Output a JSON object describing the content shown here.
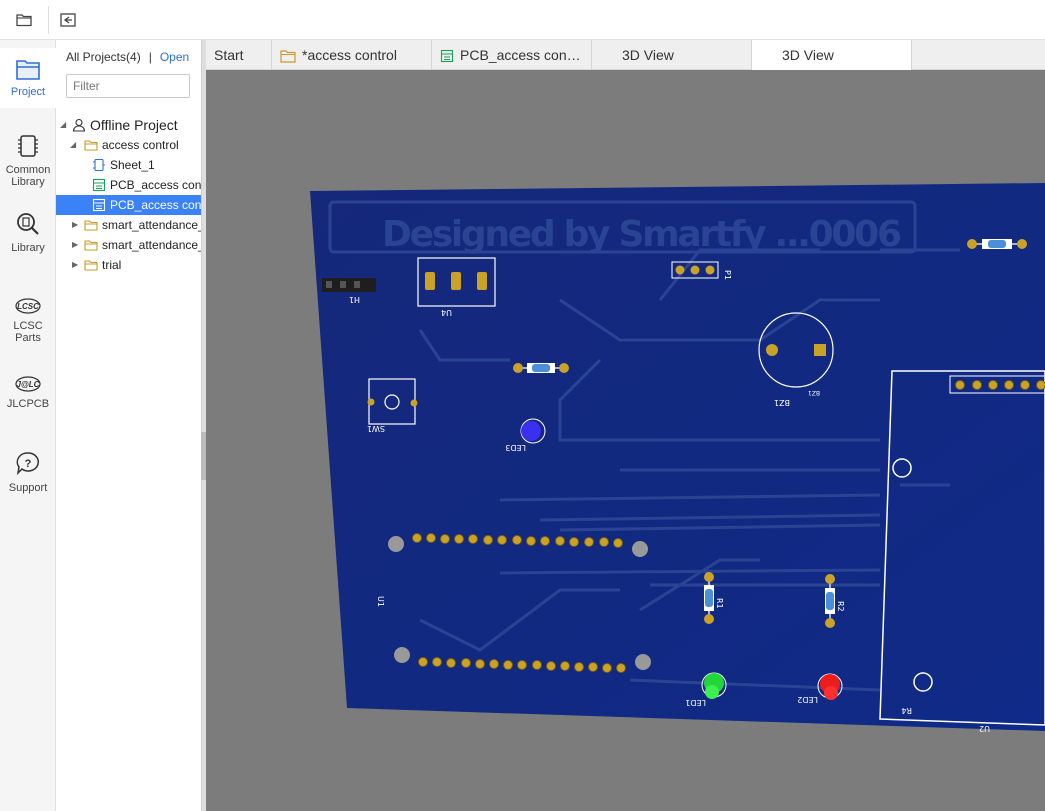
{
  "rail": {
    "items": [
      {
        "label": "Project",
        "icon": "project-icon"
      },
      {
        "label": "Common\nLibrary",
        "icon": "chip-icon"
      },
      {
        "label": "Library",
        "icon": "library-search-icon"
      },
      {
        "label": "LCSC\nParts",
        "icon": "lcsc-icon"
      },
      {
        "label": "JLCPCB",
        "icon": "jlc-icon"
      },
      {
        "label": "Support",
        "icon": "help-icon"
      }
    ]
  },
  "panel": {
    "all_projects": "All Projects(4)",
    "separator": "|",
    "open": "Open",
    "filter_placeholder": "Filter",
    "tree": [
      {
        "label": "Offline Project",
        "type": "user"
      },
      {
        "label": "access control",
        "type": "folder"
      },
      {
        "label": "Sheet_1",
        "type": "sheet"
      },
      {
        "label": "PCB_access control",
        "type": "pcb-green"
      },
      {
        "label": "PCB_access control",
        "type": "pcb"
      },
      {
        "label": "smart_attendance_",
        "type": "folder"
      },
      {
        "label": "smart_attendance_",
        "type": "folder"
      },
      {
        "label": "trial",
        "type": "folder"
      }
    ]
  },
  "tabs": [
    {
      "label": "Start"
    },
    {
      "label": "*access control",
      "icon": "folder-icon"
    },
    {
      "label": "PCB_access con…",
      "icon": "pcb-icon"
    },
    {
      "label": "3D View"
    },
    {
      "label": "3D View",
      "active": true
    }
  ],
  "pcb": {
    "silkscreen_title": "Designed by Smartfy ...0006",
    "labels": {
      "h1": "H1",
      "u4": "U4",
      "p1": "P1",
      "bz1": "BZ1",
      "bz1b": "BZ1",
      "sw1": "SW1",
      "led3": "LED3",
      "u1": "U1",
      "r1": "R1",
      "r2": "R2",
      "led1": "LED1",
      "led2": "LED2",
      "r4": "R4",
      "u2": "U2"
    },
    "colors": {
      "board": "#142a7a",
      "background": "#7c7c7c",
      "pad": "#c9a227",
      "silk": "#ffffff",
      "led_blue": "#3b2ff0",
      "led_green": "#22d63a",
      "led_red": "#ee1c1c"
    }
  }
}
